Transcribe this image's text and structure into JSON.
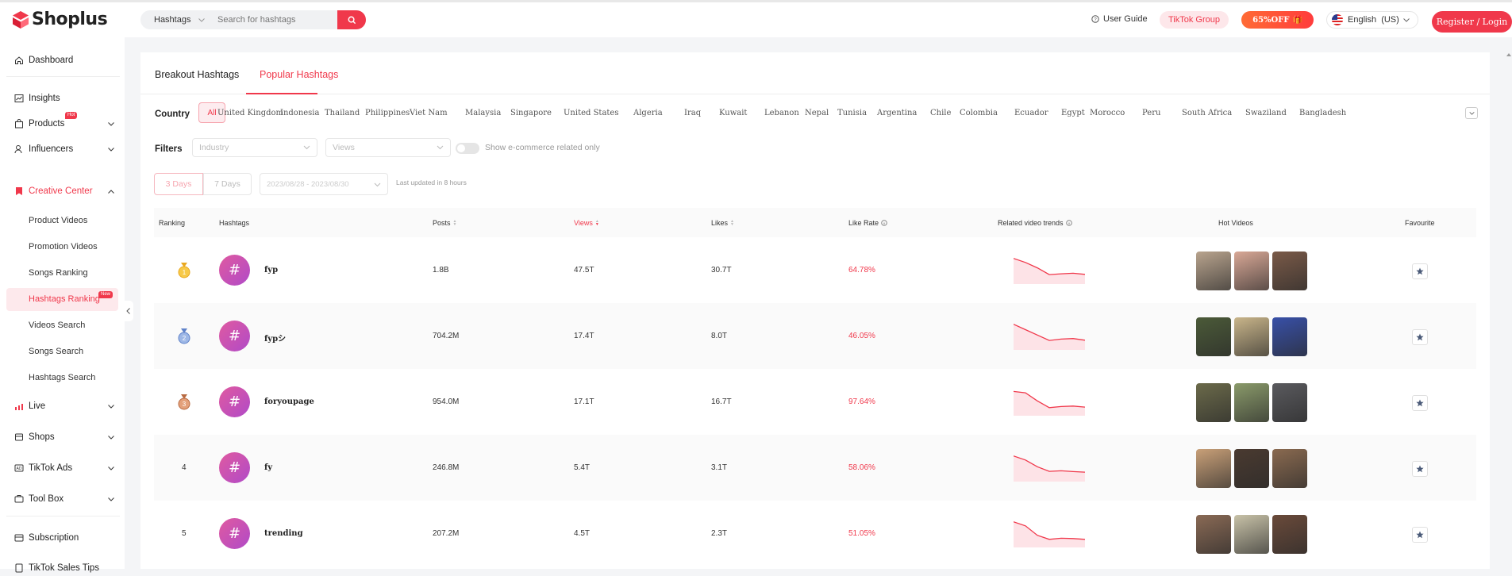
{
  "header": {
    "logo_text": "Shoplus",
    "search_type": "Hashtags",
    "search_placeholder": "Search for hashtags",
    "user_guide": "User Guide",
    "tiktok_group": "TikTok Group",
    "promo": "65%OFF",
    "language": "English  (US)",
    "login": "Register / Login"
  },
  "sidebar": {
    "dashboard": "Dashboard",
    "insights": "Insights",
    "products": "Products",
    "products_badge": "Hot",
    "influencers": "Influencers",
    "creative_center": "Creative Center",
    "sub_items": [
      "Product Videos",
      "Promotion Videos",
      "Songs Ranking",
      "Hashtags Ranking",
      "Videos Search",
      "Songs Search",
      "Hashtags Search"
    ],
    "new_badge": "New",
    "live": "Live",
    "shops": "Shops",
    "tiktok_ads": "TikTok Ads",
    "tool_box": "Tool Box",
    "subscription": "Subscription",
    "sales_tips": "TikTok Sales Tips"
  },
  "tabs": [
    "Breakout Hashtags",
    "Popular Hashtags"
  ],
  "filters": {
    "country_label": "Country",
    "countries": [
      "All",
      "United Kingdom",
      "Indonesia",
      "Thailand",
      "Philippines",
      "Viet Nam",
      "Malaysia",
      "Singapore",
      "United States",
      "Algeria",
      "Iraq",
      "Kuwait",
      "Lebanon",
      "Nepal",
      "Tunisia",
      "Argentina",
      "Chile",
      "Colombia",
      "Ecuador",
      "Egypt",
      "Morocco",
      "Peru",
      "South Africa",
      "Swaziland",
      "Bangladesh"
    ],
    "filters_label": "Filters",
    "industry_placeholder": "Industry",
    "views_placeholder": "Views",
    "ecommerce_toggle": "Show e-commerce related only",
    "days": [
      "3 Days",
      "7 Days"
    ],
    "date_range": "2023/08/28 - 2023/08/30",
    "last_updated": "Last updated in 8 hours"
  },
  "table": {
    "columns": {
      "ranking": "Ranking",
      "hashtags": "Hashtags",
      "posts": "Posts",
      "views": "Views",
      "likes": "Likes",
      "like_rate": "Like Rate",
      "trends": "Related video trends",
      "hot_videos": "Hot Videos",
      "favourite": "Favourite"
    },
    "rows": [
      {
        "rank": "1",
        "tag": "fyp",
        "posts": "1.8B",
        "views": "47.5T",
        "likes": "30.7T",
        "like_rate": "64.78%",
        "trend": [
          0.95,
          0.8,
          0.6,
          0.35,
          0.38,
          0.4,
          0.36
        ],
        "thumbs": [
          "#b9a48e",
          "#d9a896",
          "#7a5a48"
        ]
      },
      {
        "rank": "2",
        "tag": "fypシ",
        "posts": "704.2M",
        "views": "17.4T",
        "likes": "8.0T",
        "like_rate": "46.05%",
        "trend": [
          0.95,
          0.75,
          0.55,
          0.35,
          0.4,
          0.42,
          0.36
        ],
        "thumbs": [
          "#4b5a38",
          "#c9b58a",
          "#3850a8"
        ]
      },
      {
        "rank": "3",
        "tag": "foryoupage",
        "posts": "954.0M",
        "views": "17.1T",
        "likes": "16.7T",
        "like_rate": "97.64%",
        "trend": [
          0.9,
          0.85,
          0.55,
          0.3,
          0.34,
          0.36,
          0.32
        ],
        "thumbs": [
          "#6b6a4a",
          "#8a9a6a",
          "#5a5a5e"
        ]
      },
      {
        "rank": "4",
        "tag": "fy",
        "posts": "246.8M",
        "views": "5.4T",
        "likes": "3.1T",
        "like_rate": "58.06%",
        "trend": [
          0.95,
          0.8,
          0.55,
          0.38,
          0.4,
          0.37,
          0.35
        ],
        "thumbs": [
          "#c9a078",
          "#4a3a30",
          "#8a6a50"
        ]
      },
      {
        "rank": "5",
        "tag": "trending",
        "posts": "207.2M",
        "views": "4.5T",
        "likes": "2.3T",
        "like_rate": "51.05%",
        "trend": [
          0.95,
          0.8,
          0.45,
          0.3,
          0.34,
          0.33,
          0.3
        ],
        "thumbs": [
          "#8a6a55",
          "#c8c2a8",
          "#6a4a3a"
        ]
      }
    ]
  },
  "colors": {
    "accent": "#f0384b",
    "panel_bg": "#ffffff",
    "page_bg": "#f4f5f7"
  }
}
